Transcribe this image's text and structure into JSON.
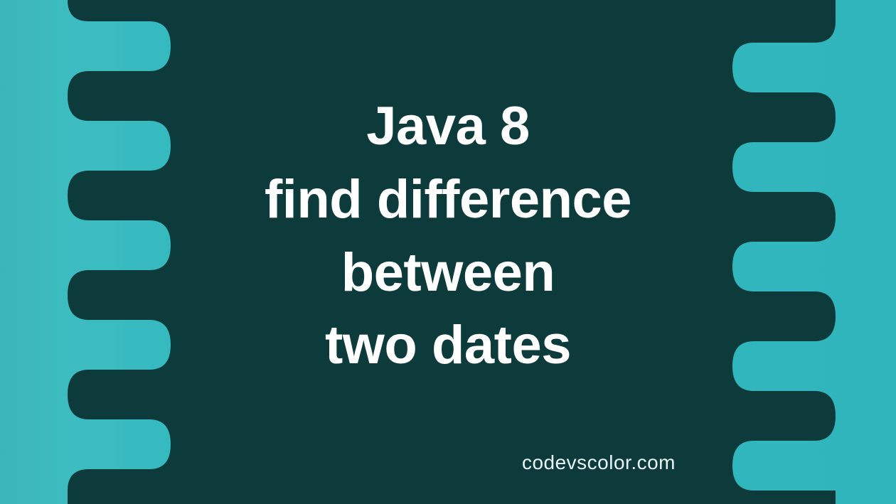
{
  "title": {
    "line1": "Java 8",
    "line2": "find difference",
    "line3": "between",
    "line4": "two dates"
  },
  "attribution": "codevscolor.com",
  "colors": {
    "background_teal": "#34b9bf",
    "dark_blob": "#0d3b3c",
    "text": "#ffffff"
  }
}
